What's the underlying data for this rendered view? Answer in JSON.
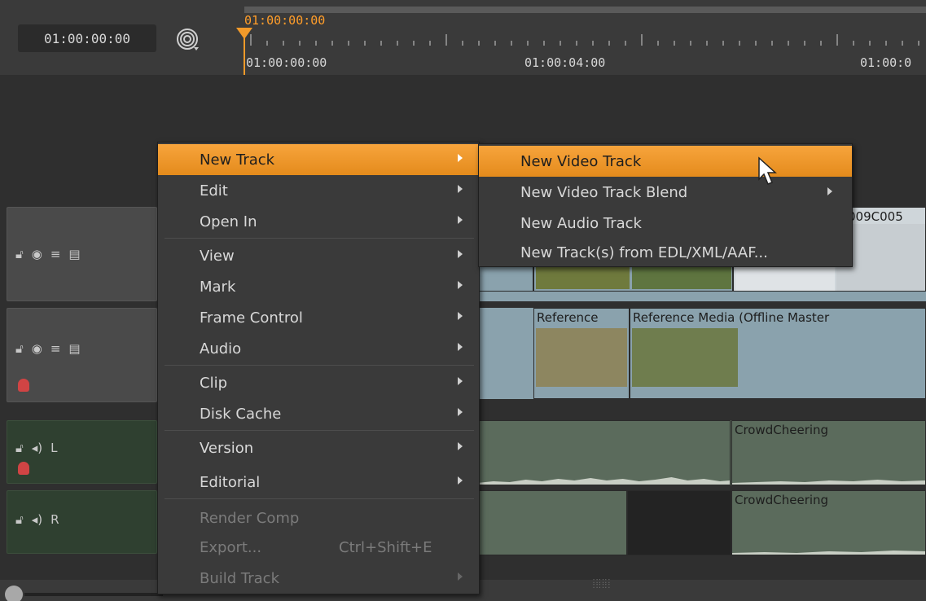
{
  "header": {
    "current_timecode": "01:00:00:00",
    "playhead_timecode": "01:00:00:00",
    "ruler_labels": [
      "01:00:00:00",
      "01:00:04:00",
      "01:00:0"
    ]
  },
  "tracks": {
    "video": [
      {
        "clips": [
          {
            "label": ""
          },
          {
            "label": ""
          },
          {
            "label": "009C005"
          }
        ]
      },
      {
        "clips": [
          {
            "label": "Reference"
          },
          {
            "label": "Reference Media (Offline Master"
          }
        ]
      }
    ],
    "audio": [
      {
        "channel_label": "L",
        "clips": [
          {
            "label": "CrowdCheering"
          }
        ]
      },
      {
        "channel_label": "R",
        "clips": [
          {
            "label": "CrowdCheering"
          }
        ]
      }
    ]
  },
  "context_menu": {
    "items": [
      {
        "label": "New Track",
        "submenu": true,
        "state": "active"
      },
      {
        "label": "Edit",
        "submenu": true,
        "state": "normal"
      },
      {
        "label": "Open In",
        "submenu": true,
        "state": "normal"
      },
      {
        "label": "View",
        "submenu": true,
        "state": "normal"
      },
      {
        "label": "Mark",
        "submenu": true,
        "state": "normal"
      },
      {
        "label": "Frame Control",
        "submenu": true,
        "state": "normal"
      },
      {
        "label": "Audio",
        "submenu": true,
        "state": "normal"
      },
      {
        "label": "Clip",
        "submenu": true,
        "state": "normal"
      },
      {
        "label": "Disk Cache",
        "submenu": true,
        "state": "normal"
      },
      {
        "label": "Version",
        "submenu": true,
        "state": "normal"
      },
      {
        "label": "Editorial",
        "submenu": true,
        "state": "normal"
      },
      {
        "label": "Render Comp",
        "submenu": false,
        "state": "disabled"
      },
      {
        "label": "Export...",
        "shortcut": "Ctrl+Shift+E",
        "submenu": false,
        "state": "disabled"
      },
      {
        "label": "Build Track",
        "submenu": true,
        "state": "disabled"
      }
    ]
  },
  "submenu": {
    "items": [
      {
        "label": "New Video Track",
        "submenu": false,
        "state": "active"
      },
      {
        "label": "New Video Track Blend",
        "submenu": true,
        "state": "normal"
      },
      {
        "label": "New Audio Track",
        "submenu": false,
        "state": "normal"
      },
      {
        "label": "New Track(s) from EDL/XML/AAF...",
        "submenu": false,
        "state": "normal"
      }
    ]
  },
  "icons": [
    "target-icon",
    "lock-icon",
    "eye-icon",
    "layers-icon",
    "database-icon",
    "speaker-icon",
    "record-icon",
    "mouse-pointer-icon"
  ],
  "colors": {
    "accent": "#f29a2a",
    "video_track": "#8aa2ad",
    "audio_track": "#5b6b5c",
    "menu_bg": "#3a3a3a"
  }
}
